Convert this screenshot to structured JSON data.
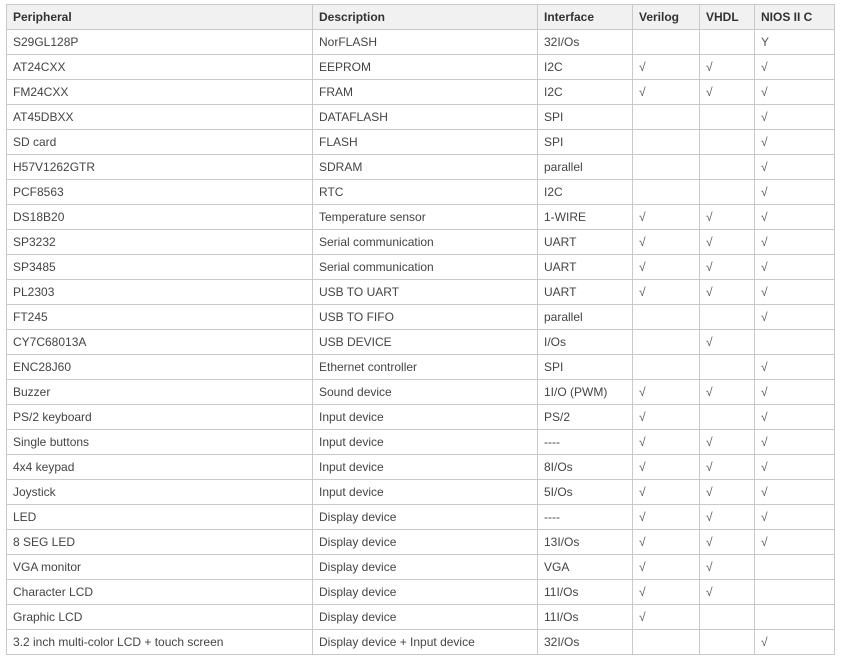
{
  "table": {
    "headers": [
      "Peripheral",
      "Description",
      "Interface",
      "Verilog",
      "VHDL",
      "NIOS II C"
    ],
    "rows": [
      [
        "S29GL128P",
        "NorFLASH",
        "32I/Os",
        "",
        "",
        "Y"
      ],
      [
        "AT24CXX",
        "EEPROM",
        "I2C",
        "√",
        "√",
        "√"
      ],
      [
        "FM24CXX",
        "FRAM",
        "I2C",
        "√",
        "√",
        "√"
      ],
      [
        "AT45DBXX",
        "DATAFLASH",
        "SPI",
        "",
        "",
        "√"
      ],
      [
        "SD card",
        "FLASH",
        "SPI",
        "",
        "",
        "√"
      ],
      [
        "H57V1262GTR",
        "SDRAM",
        "parallel",
        "",
        "",
        "√"
      ],
      [
        "PCF8563",
        "RTC",
        "I2C",
        "",
        "",
        "√"
      ],
      [
        "DS18B20",
        "Temperature sensor",
        "1-WIRE",
        "√",
        "√",
        "√"
      ],
      [
        "SP3232",
        "Serial communication",
        "UART",
        "√",
        "√",
        "√"
      ],
      [
        "SP3485",
        "Serial communication",
        "UART",
        "√",
        "√",
        "√"
      ],
      [
        "PL2303",
        "USB TO UART",
        "UART",
        "√",
        "√",
        "√"
      ],
      [
        "FT245",
        "USB TO FIFO",
        "parallel",
        "",
        "",
        "√"
      ],
      [
        "CY7C68013A",
        "USB DEVICE",
        "I/Os",
        "",
        "√",
        ""
      ],
      [
        "ENC28J60",
        "Ethernet controller",
        "SPI",
        "",
        "",
        "√"
      ],
      [
        "Buzzer",
        "Sound device",
        "1I/O (PWM)",
        "√",
        "√",
        "√"
      ],
      [
        "PS/2 keyboard",
        "Input device",
        "PS/2",
        "√",
        "",
        "√"
      ],
      [
        "Single buttons",
        "Input device",
        "----",
        "√",
        "√",
        "√"
      ],
      [
        "4x4 keypad",
        "Input device",
        "8I/Os",
        "√",
        "√",
        "√"
      ],
      [
        "Joystick",
        "Input device",
        "5I/Os",
        "√",
        "√",
        "√"
      ],
      [
        "LED",
        "Display device",
        "----",
        "√",
        "√",
        "√"
      ],
      [
        "8 SEG LED",
        "Display device",
        "13I/Os",
        "√",
        "√",
        "√"
      ],
      [
        "VGA monitor",
        "Display device",
        "VGA",
        "√",
        "√",
        ""
      ],
      [
        "Character LCD",
        "Display device",
        "11I/Os",
        "√",
        "√",
        ""
      ],
      [
        "Graphic LCD",
        "Display device",
        "11I/Os",
        "√",
        "",
        ""
      ],
      [
        "3.2 inch multi-color LCD + touch screen",
        "Display device + Input device",
        "32I/Os",
        "",
        "",
        "√"
      ]
    ]
  }
}
